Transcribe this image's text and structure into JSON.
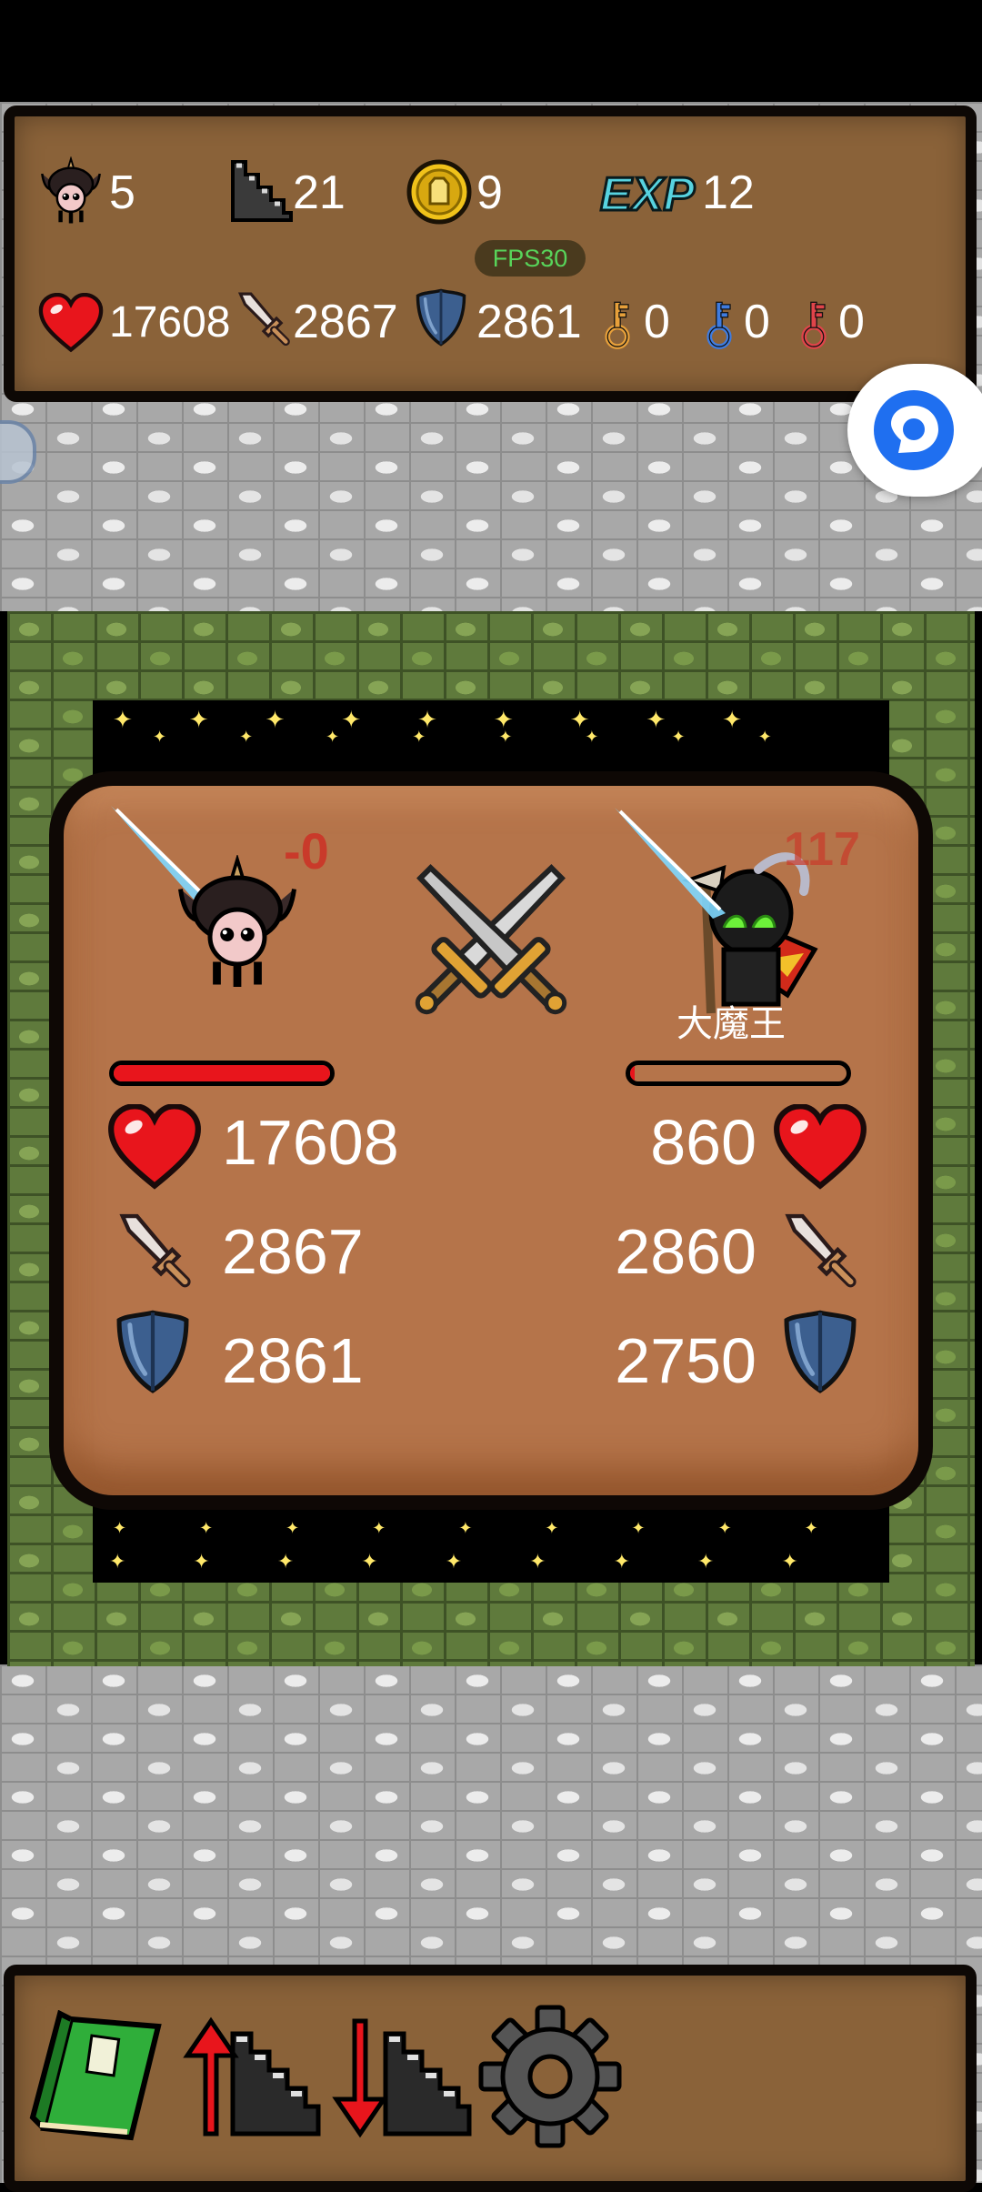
{
  "hud": {
    "level": "5",
    "floor": "21",
    "gold": "9",
    "exp_label": "EXP",
    "exp": "12",
    "fps": "FPS30",
    "hp": "17608",
    "attack": "2867",
    "defense": "2861",
    "yellow_keys": "0",
    "blue_keys": "0",
    "red_keys": "0"
  },
  "battle": {
    "player": {
      "damage_taken": "-0",
      "hp": "17608",
      "attack": "2867",
      "defense": "2861",
      "hp_fraction": 1.0
    },
    "enemy": {
      "name": "大魔王",
      "damage_taken": "117",
      "hp": "860",
      "attack": "2860",
      "defense": "2750",
      "hp_fraction": 0.02
    }
  },
  "toolbar": {
    "items": [
      "book-icon",
      "stairs-up-icon",
      "stairs-down-icon",
      "settings-gear-icon"
    ]
  },
  "colors": {
    "wood": "#8a6239",
    "battle_card": "#b5744a",
    "hp_red": "#e8151c",
    "damage_text": "#c93a2a",
    "fps_green": "#58d45a"
  }
}
